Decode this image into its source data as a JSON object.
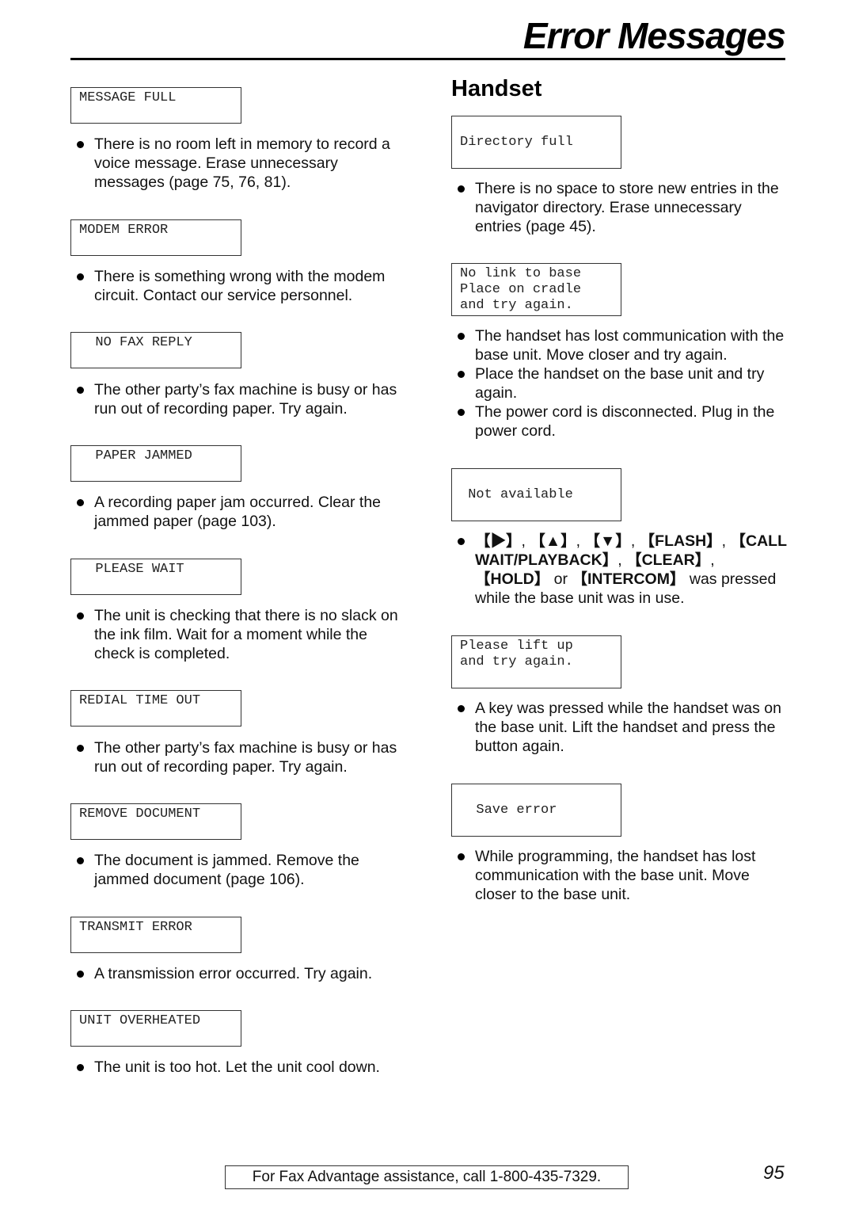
{
  "header": {
    "title": "Error Messages"
  },
  "left_column": {
    "entries": [
      {
        "display": "MESSAGE FULL",
        "bullets": [
          "There is no room left in memory to record a voice message. Erase unnecessary messages (page 75, 76, 81)."
        ]
      },
      {
        "display": "MODEM ERROR",
        "bullets": [
          "There is something wrong with the modem circuit. Contact our service personnel."
        ]
      },
      {
        "display": "  NO FAX REPLY",
        "bullets": [
          "The other party’s fax machine is busy or has run out of recording paper. Try again."
        ]
      },
      {
        "display": "  PAPER JAMMED",
        "bullets": [
          "A recording paper jam occurred. Clear the jammed paper (page 103)."
        ]
      },
      {
        "display": "  PLEASE WAIT",
        "bullets": [
          "The unit is checking that there is no slack on the ink film. Wait for a moment while the check is completed."
        ]
      },
      {
        "display": "REDIAL TIME OUT",
        "bullets": [
          "The other party’s fax machine is busy or has run out of recording paper. Try again."
        ]
      },
      {
        "display": "REMOVE DOCUMENT",
        "bullets": [
          "The document is jammed. Remove the jammed document (page 106)."
        ]
      },
      {
        "display": "TRANSMIT ERROR",
        "bullets": [
          "A transmission error occurred. Try again."
        ]
      },
      {
        "display": "UNIT OVERHEATED",
        "bullets": [
          "The unit is too hot. Let the unit cool down."
        ]
      }
    ]
  },
  "right_column": {
    "heading": "Handset",
    "entries": [
      {
        "display": "\nDirectory full",
        "bullets": [
          "There is no space to store new entries in the navigator directory. Erase unnecessary entries (page 45)."
        ]
      },
      {
        "display": "No link to base\nPlace on cradle\nand try again.",
        "bullets": [
          "The handset has lost communication with the base unit. Move closer and try again.",
          "Place the handset on the base unit and try again.",
          "The power cord is disconnected. Plug in the power cord."
        ]
      },
      {
        "display": "\n Not available",
        "keys": [
          "【▶】",
          "【▲】",
          "【▼】",
          "【FLASH】",
          "【CALL WAIT/PLAYBACK】",
          "【CLEAR】",
          "【HOLD】",
          "【INTERCOM】"
        ],
        "bullet_suffix": " was pressed while the base unit was in use.",
        "conjunction": " or "
      },
      {
        "display": "Please lift up\nand try again.",
        "bullets": [
          "A key was pressed while the handset was on the base unit. Lift the handset and press the button again."
        ]
      },
      {
        "display": "\n  Save error",
        "bullets": [
          "While programming, the handset has lost communication with the base unit. Move closer to the base unit."
        ]
      }
    ]
  },
  "footer": {
    "assistance_text": "For Fax Advantage assistance, call 1-800-435-7329.",
    "page_number": "95"
  }
}
